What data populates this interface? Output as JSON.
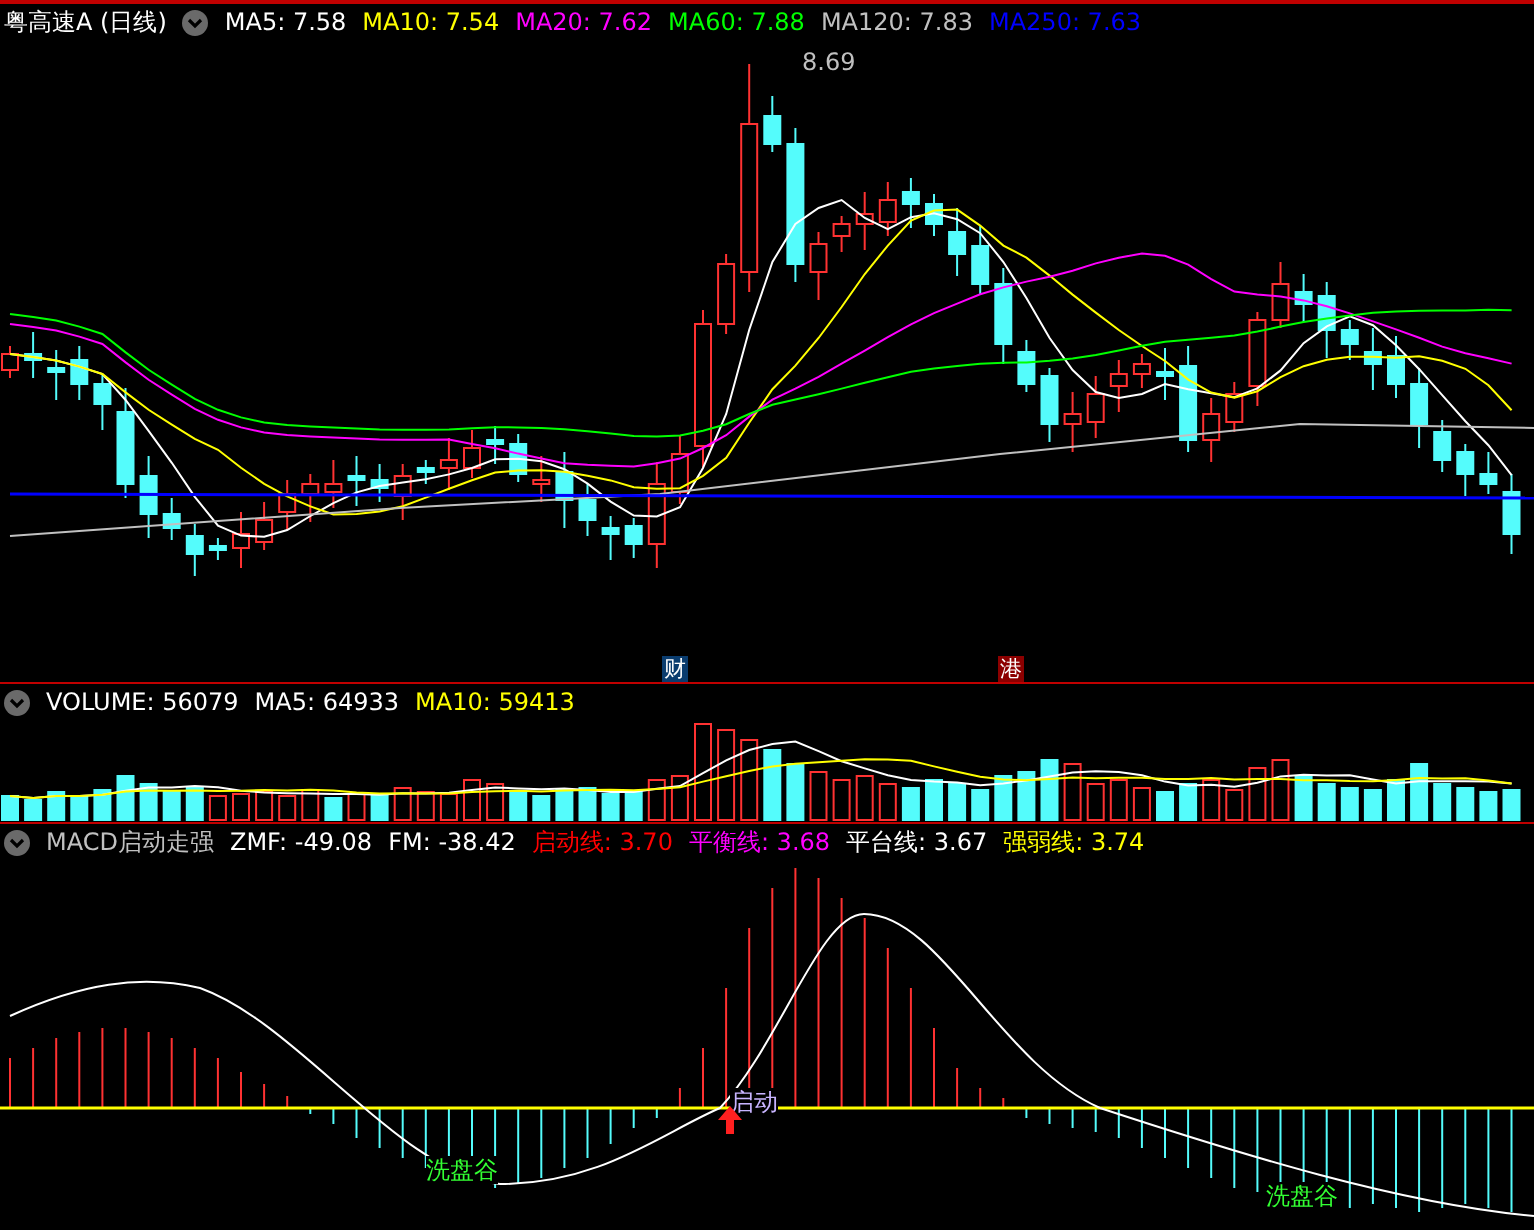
{
  "price_panel": {
    "title": "粤高速A (日线)",
    "indicators": [
      {
        "label": "MA5: 7.58",
        "color": "#ffffff"
      },
      {
        "label": "MA10: 7.54",
        "color": "#ffff00"
      },
      {
        "label": "MA20: 7.62",
        "color": "#ff00ff"
      },
      {
        "label": "MA60: 7.88",
        "color": "#00ff00"
      },
      {
        "label": "MA120: 7.83",
        "color": "#c0c0c0"
      },
      {
        "label": "MA250: 7.63",
        "color": "#0000ff"
      }
    ],
    "high_label": "8.69",
    "event_markers": [
      {
        "text": "财",
        "kind": "finance"
      },
      {
        "text": "港",
        "kind": "hk"
      }
    ]
  },
  "volume_panel": {
    "indicators": [
      {
        "label": "VOLUME: 56079",
        "color": "#ffffff"
      },
      {
        "label": "MA5: 64933",
        "color": "#ffffff"
      },
      {
        "label": "MA10: 59413",
        "color": "#ffff00"
      }
    ]
  },
  "macd_panel": {
    "indicators": [
      {
        "label": "MACD启动走强",
        "color": "#c0c0c0"
      },
      {
        "label": "ZMF: -49.08",
        "color": "#ffffff"
      },
      {
        "label": "FM: -38.42",
        "color": "#ffffff"
      },
      {
        "label": "启动线: 3.70",
        "color": "#ff0000"
      },
      {
        "label": "平衡线: 3.68",
        "color": "#ff00ff"
      },
      {
        "label": "平台线: 3.67",
        "color": "#ffffff"
      },
      {
        "label": "强弱线: 3.74",
        "color": "#ffff00"
      }
    ],
    "signals": [
      {
        "text": "启动",
        "kind": "start"
      },
      {
        "text": "洗盘谷",
        "kind": "valley"
      },
      {
        "text": "洗盘谷",
        "kind": "valley"
      }
    ]
  }
}
